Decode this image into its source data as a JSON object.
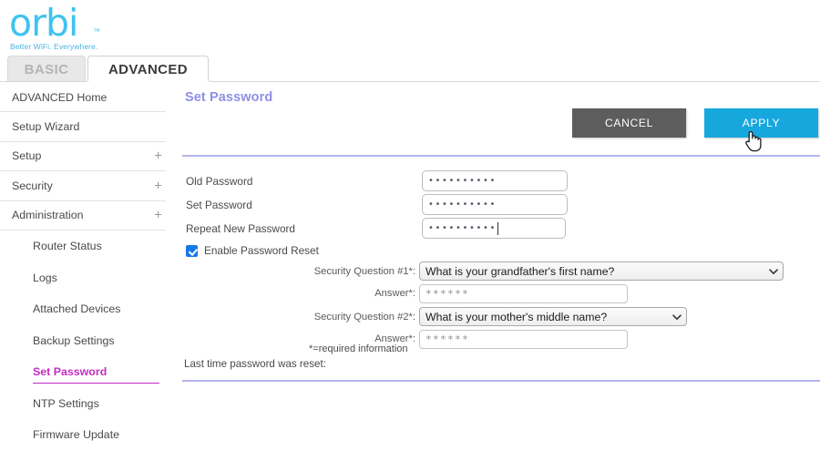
{
  "brand": {
    "logo_text": "orbi",
    "logo_tm": "™",
    "tagline": "Better WiFi. Everywhere.",
    "logo_color": "#3FC3F0"
  },
  "tabs": [
    {
      "label": "BASIC",
      "active": false
    },
    {
      "label": "ADVANCED",
      "active": true
    }
  ],
  "sidebar": {
    "items": [
      {
        "label": "ADVANCED Home",
        "expandable": false
      },
      {
        "label": "Setup Wizard",
        "expandable": false
      },
      {
        "label": "Setup",
        "expandable": true,
        "expander": "+"
      },
      {
        "label": "Security",
        "expandable": true,
        "expander": "+"
      },
      {
        "label": "Administration",
        "expandable": true,
        "expander": "+"
      }
    ],
    "subitems": [
      {
        "label": "Router Status",
        "active": false
      },
      {
        "label": "Logs",
        "active": false
      },
      {
        "label": "Attached Devices",
        "active": false
      },
      {
        "label": "Backup Settings",
        "active": false
      },
      {
        "label": "Set Password",
        "active": true
      },
      {
        "label": "NTP Settings",
        "active": false
      },
      {
        "label": "Firmware Update",
        "active": false
      }
    ],
    "active_color": "#c42cc4"
  },
  "main": {
    "title": "Set Password",
    "title_color": "#8f8fe8",
    "buttons": {
      "cancel": "CANCEL",
      "apply": "APPLY",
      "cancel_color": "#5d5d5d",
      "apply_color": "#16a7dd"
    },
    "fields": {
      "old_password_label": "Old Password",
      "old_password_value": "••••••••••",
      "set_password_label": "Set Password",
      "set_password_value": "••••••••••",
      "repeat_password_label": "Repeat New Password",
      "repeat_password_value": "••••••••••"
    },
    "enable_reset": {
      "label": "Enable Password Reset",
      "checked": true
    },
    "security": {
      "q1_label": "Security Question #1*:",
      "q1_value": "What is your grandfather's first name?",
      "a1_label": "Answer*:",
      "a1_value": "******",
      "q2_label": "Security Question #2*:",
      "q2_value": "What is your mother's middle name?",
      "a2_label": "Answer*:",
      "a2_value": "******"
    },
    "required_note": "*=required information",
    "last_reset_label": "Last time password was reset:",
    "divider_color": "#b5b5ee"
  }
}
